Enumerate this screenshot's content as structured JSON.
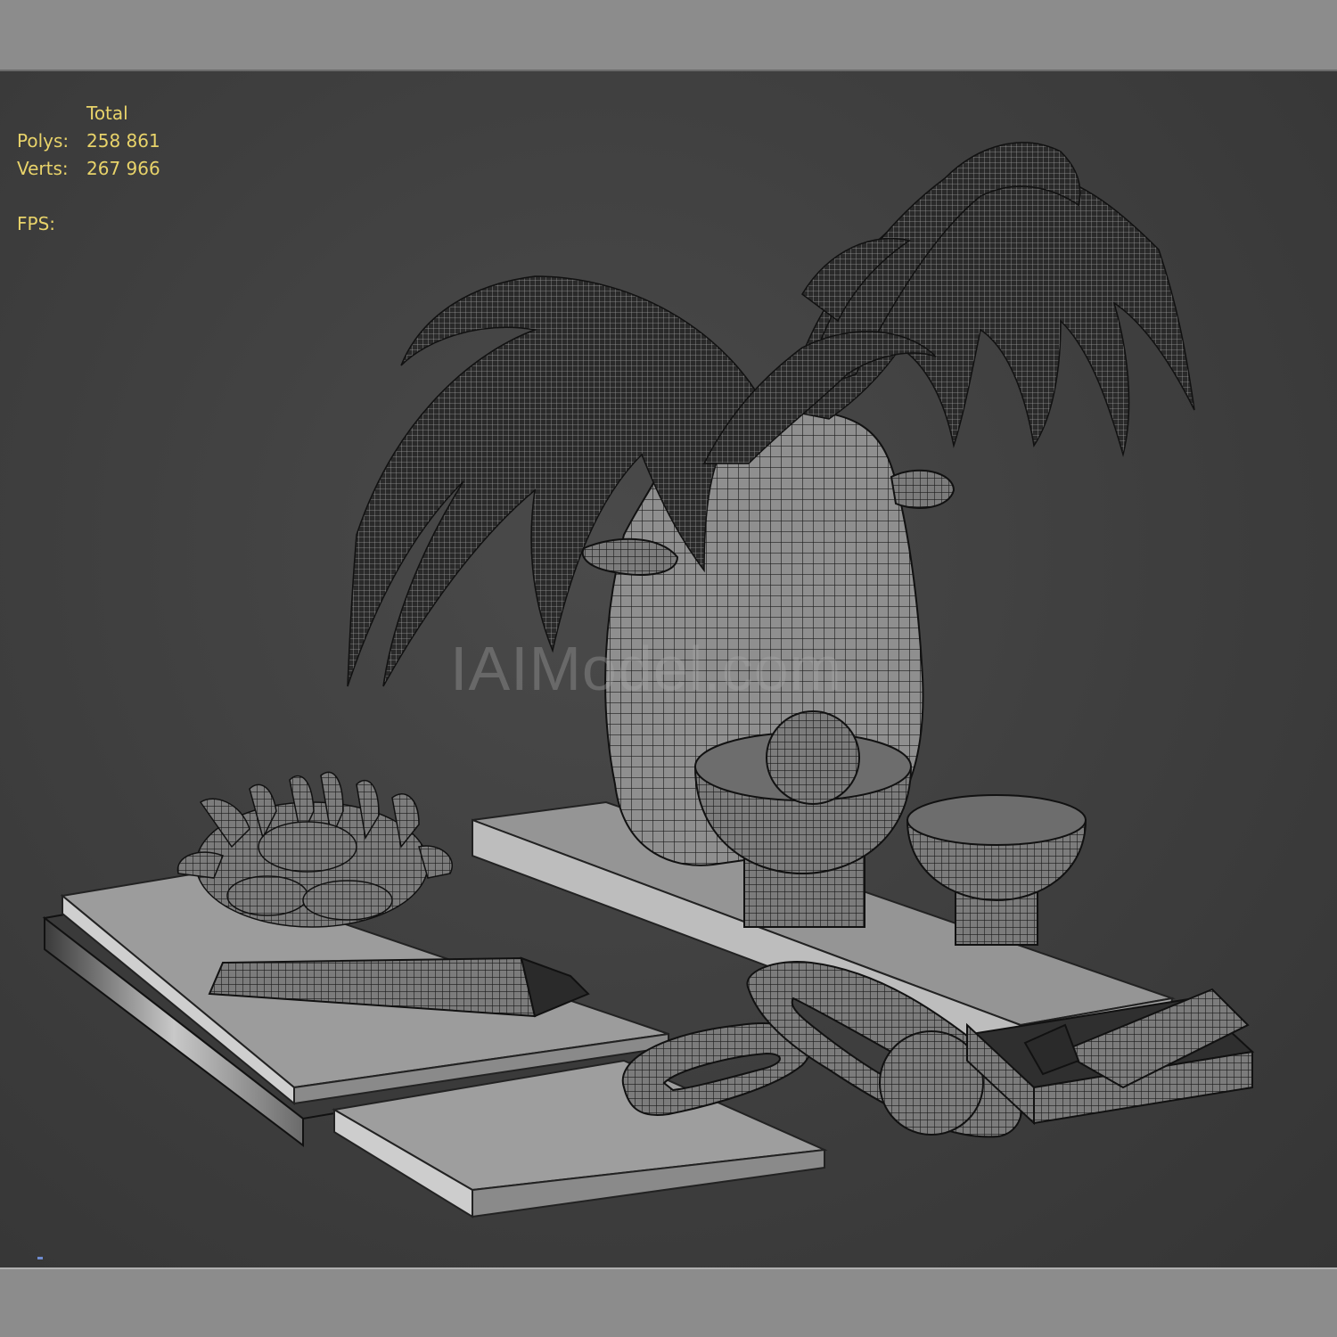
{
  "viewport": {
    "stats": {
      "header": "Total",
      "polys_label": "Polys:",
      "polys_value": "258 861",
      "verts_label": "Verts:",
      "verts_value": "267 966",
      "fps_label": "FPS:"
    },
    "watermark": "IAIModel.com",
    "colors": {
      "stats_text": "#e8d36a",
      "viewport_bg": "#3e3e3e",
      "frame_bg": "#8c8c8c",
      "wireframe": "#1a1a1a",
      "surface": "#8e8e8e"
    }
  }
}
